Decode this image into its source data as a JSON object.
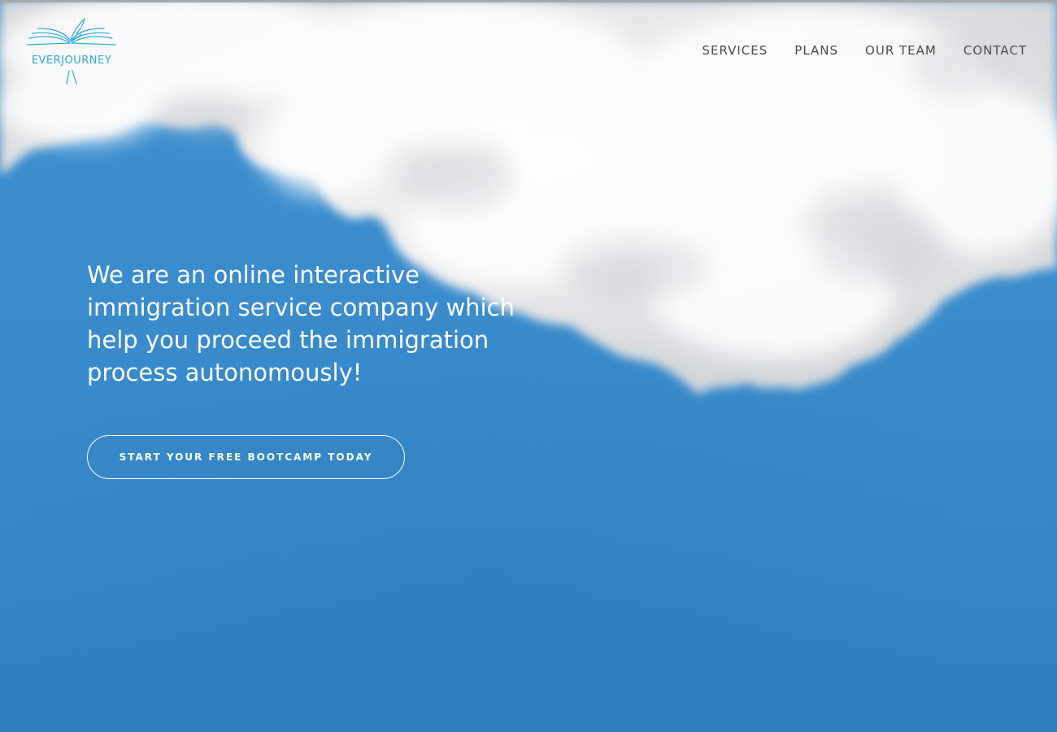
{
  "brand": {
    "name": "EVERJOURNEY",
    "logo_icon": "open-book-quill-icon",
    "color": "#2fa9dc"
  },
  "nav": {
    "items": [
      {
        "label": "SERVICES"
      },
      {
        "label": "PLANS"
      },
      {
        "label": "OUR TEAM"
      },
      {
        "label": "CONTACT"
      }
    ]
  },
  "hero": {
    "headline": "We are an online interactive immigration service company which help you proceed the immigration process autonomously!",
    "cta_label": "START YOUR FREE BOOTCAMP TODAY",
    "background": "sky-with-clouds",
    "sky_color": "#3a8ccc"
  }
}
